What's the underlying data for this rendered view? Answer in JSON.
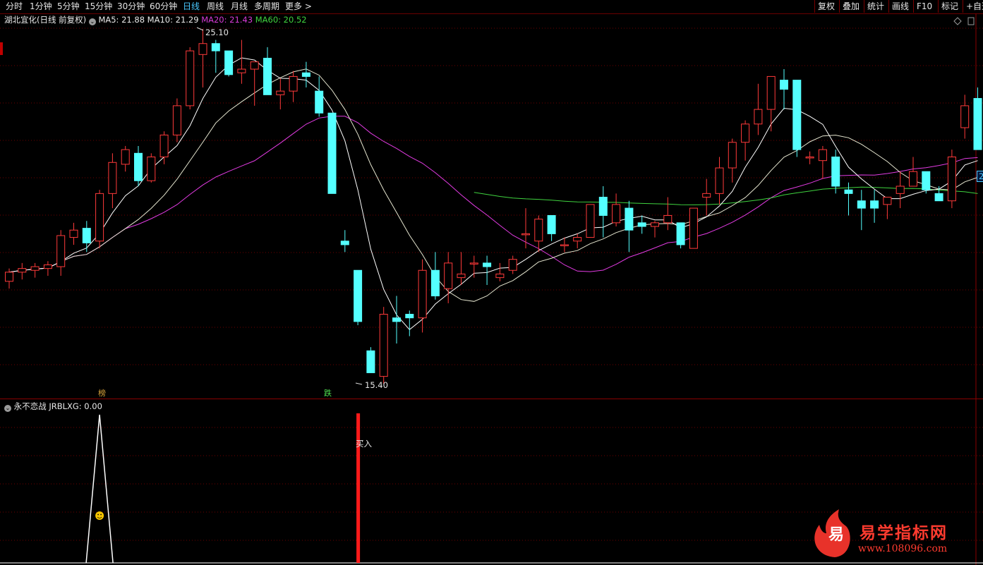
{
  "toolbar": {
    "tabs": [
      "分时",
      "1分钟",
      "5分钟",
      "15分钟",
      "30分钟",
      "60分钟",
      "日线",
      "周线",
      "月线",
      "多周期",
      "更多 >"
    ],
    "active_tab": "日线",
    "right_buttons": [
      "复权",
      "叠加",
      "统计",
      "画线",
      "F10",
      "标记",
      "+自选"
    ]
  },
  "header": {
    "stock": "湖北宜化(日线 前复权)",
    "ma5": "MA5: 21.88",
    "ma10": "MA10: 21.29",
    "ma20": "MA20: 21.43",
    "ma60": "MA60: 20.52",
    "high_label": "25.10",
    "low_label": "15.40",
    "right_price_tag": "2"
  },
  "markers": {
    "left": "榜",
    "right": "跌"
  },
  "indicator": {
    "title": "永不恋战",
    "value": "JRBLXG: 0.00",
    "signal": "买入"
  },
  "watermark": {
    "text": "易学指标网",
    "url": "www.108096.com",
    "logo_char": "易"
  },
  "colors": {
    "up": "#ff3a3a",
    "down": "#54ffff",
    "ma5": "#ffffff",
    "ma10": "#e6e6d0",
    "ma20": "#e23be2",
    "ma60": "#3fd33f",
    "grid": "#6e0000",
    "signal": "#ff1a1a"
  },
  "chart_data": {
    "type": "candlestick",
    "title": "湖北宜化(日线 前复权)",
    "y_high": 25.1,
    "y_low": 15.4,
    "candles_ohlc": [
      [
        18.2,
        18.55,
        18.0,
        18.45
      ],
      [
        18.45,
        18.7,
        18.25,
        18.55
      ],
      [
        18.5,
        18.7,
        18.3,
        18.6
      ],
      [
        18.55,
        18.75,
        18.35,
        18.65
      ],
      [
        18.6,
        19.6,
        18.35,
        19.45
      ],
      [
        19.4,
        19.8,
        19.2,
        19.6
      ],
      [
        19.65,
        19.85,
        19.0,
        19.25
      ],
      [
        19.3,
        20.7,
        19.1,
        20.6
      ],
      [
        20.6,
        21.7,
        20.2,
        21.45
      ],
      [
        21.4,
        21.9,
        21.2,
        21.8
      ],
      [
        21.7,
        21.9,
        20.8,
        20.95
      ],
      [
        20.95,
        21.7,
        20.9,
        21.6
      ],
      [
        21.6,
        22.3,
        21.4,
        22.2
      ],
      [
        22.2,
        23.2,
        22.0,
        23.0
      ],
      [
        23.0,
        24.6,
        22.9,
        24.5
      ],
      [
        24.4,
        25.1,
        23.5,
        24.7
      ],
      [
        24.7,
        24.8,
        23.9,
        24.5
      ],
      [
        24.5,
        24.5,
        23.8,
        23.85
      ],
      [
        23.9,
        24.8,
        23.6,
        24.0
      ],
      [
        24.0,
        24.2,
        23.0,
        24.2
      ],
      [
        24.3,
        24.6,
        23.7,
        23.3
      ],
      [
        23.3,
        23.75,
        22.9,
        23.4
      ],
      [
        23.4,
        23.95,
        23.1,
        23.8
      ],
      [
        23.9,
        24.2,
        23.5,
        23.8
      ],
      [
        23.4,
        23.8,
        22.7,
        22.8
      ],
      [
        22.8,
        22.8,
        21.2,
        20.6
      ],
      [
        19.3,
        19.6,
        19.0,
        19.2
      ],
      [
        18.5,
        18.5,
        17.0,
        17.1
      ],
      [
        16.3,
        16.4,
        15.7,
        15.7
      ],
      [
        15.6,
        17.5,
        15.4,
        17.3
      ],
      [
        17.2,
        17.8,
        16.5,
        17.1
      ],
      [
        17.3,
        17.4,
        16.7,
        17.2
      ],
      [
        17.2,
        18.8,
        16.8,
        18.5
      ],
      [
        18.5,
        19.0,
        17.7,
        17.8
      ],
      [
        18.0,
        19.0,
        17.6,
        18.7
      ],
      [
        18.3,
        19.0,
        18.1,
        18.4
      ],
      [
        18.7,
        18.9,
        18.3,
        18.7
      ],
      [
        18.7,
        18.9,
        18.1,
        18.6
      ],
      [
        18.3,
        18.7,
        18.2,
        18.4
      ],
      [
        18.5,
        18.9,
        18.4,
        18.8
      ],
      [
        19.5,
        20.2,
        19.1,
        19.5
      ],
      [
        19.3,
        20.0,
        19.0,
        19.9
      ],
      [
        20.0,
        20.0,
        19.3,
        19.5
      ],
      [
        19.2,
        19.4,
        19.0,
        19.2
      ],
      [
        19.3,
        19.5,
        19.1,
        19.4
      ],
      [
        19.4,
        20.3,
        19.4,
        20.3
      ],
      [
        20.5,
        20.8,
        19.4,
        20.0
      ],
      [
        19.8,
        20.6,
        19.7,
        20.3
      ],
      [
        20.2,
        20.4,
        19.0,
        19.6
      ],
      [
        19.8,
        20.0,
        19.5,
        19.7
      ],
      [
        19.7,
        19.85,
        19.4,
        19.8
      ],
      [
        19.8,
        20.5,
        19.6,
        20.0
      ],
      [
        19.8,
        19.8,
        19.1,
        19.2
      ],
      [
        19.1,
        20.2,
        19.1,
        20.2
      ],
      [
        20.5,
        21.0,
        20.0,
        20.6
      ],
      [
        20.6,
        21.6,
        20.3,
        21.3
      ],
      [
        21.3,
        22.1,
        20.9,
        22.0
      ],
      [
        22.0,
        22.6,
        21.5,
        22.5
      ],
      [
        22.5,
        23.6,
        22.2,
        22.9
      ],
      [
        22.9,
        23.8,
        22.3,
        23.8
      ],
      [
        23.7,
        24.0,
        22.9,
        23.45
      ],
      [
        23.7,
        23.7,
        21.6,
        21.8
      ],
      [
        21.6,
        21.75,
        21.4,
        21.6
      ],
      [
        21.5,
        21.9,
        21.0,
        21.8
      ],
      [
        21.6,
        21.8,
        20.6,
        20.8
      ],
      [
        20.7,
        20.9,
        20.0,
        20.6
      ],
      [
        20.4,
        20.7,
        19.6,
        20.2
      ],
      [
        20.4,
        20.7,
        19.8,
        20.2
      ],
      [
        20.3,
        20.5,
        19.9,
        20.5
      ],
      [
        20.6,
        21.2,
        20.2,
        20.8
      ],
      [
        20.8,
        21.6,
        20.9,
        21.2
      ],
      [
        21.2,
        21.2,
        20.6,
        20.7
      ],
      [
        20.6,
        20.8,
        20.4,
        20.4
      ],
      [
        20.4,
        21.8,
        20.2,
        21.6
      ],
      [
        22.4,
        23.3,
        22.1,
        23.0
      ],
      [
        23.2,
        23.5,
        22.0,
        21.8
      ]
    ],
    "indicator_signals": [
      {
        "type": "spike",
        "index": 7
      },
      {
        "type": "buy",
        "index": 27,
        "label": "买入"
      }
    ]
  }
}
